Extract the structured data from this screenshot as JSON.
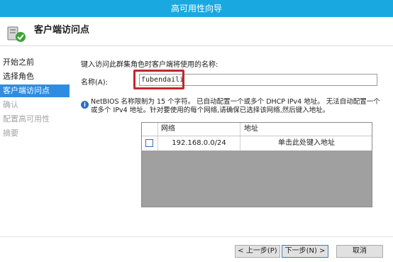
{
  "window": {
    "title": "高可用性向导"
  },
  "header": {
    "title": "客户端访问点"
  },
  "sidebar": {
    "items": [
      {
        "label": "开始之前",
        "state": "normal"
      },
      {
        "label": "选择角色",
        "state": "normal"
      },
      {
        "label": "客户端访问点",
        "state": "active"
      },
      {
        "label": "确认",
        "state": "disabled"
      },
      {
        "label": "配置高可用性",
        "state": "disabled"
      },
      {
        "label": "摘要",
        "state": "disabled"
      }
    ]
  },
  "main": {
    "instruction": "键入访问此群集角色时客户端将使用的名称:",
    "name_label": "名称(A):",
    "name_value": "fubendaili",
    "info_text": "NetBIOS 名称限制为 15 个字符。 已自动配置一个或多个 DHCP IPv4 地址。 无法自动配置一个或多个 IPv4 地址。针对要使用的每个网络,请确保已选择该网络,然后键入地址。",
    "grid": {
      "columns": [
        "网络",
        "地址"
      ],
      "rows": [
        {
          "checked": false,
          "network": "192.168.0.0/24",
          "address": "单击此处键入地址"
        }
      ]
    }
  },
  "footer": {
    "prev_label": "< 上一步(P)",
    "next_label": "下一步(N) >",
    "cancel_label": "取消"
  },
  "colors": {
    "titlebar": "#19a9e0",
    "active_item": "#2e8de1",
    "highlight_border": "#c1272d"
  }
}
